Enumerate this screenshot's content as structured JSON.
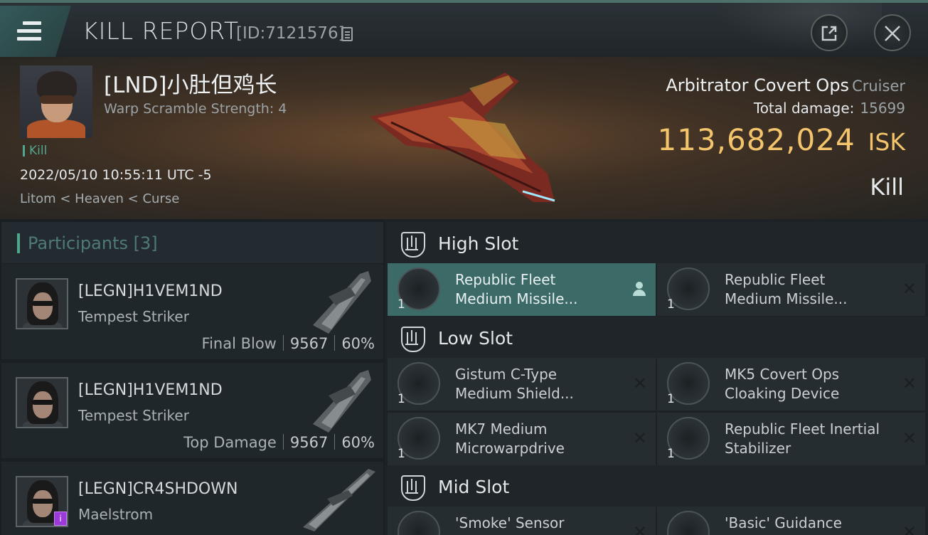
{
  "header": {
    "title": "KILL REPORT",
    "report_id": "[ID:7121576]"
  },
  "victim": {
    "name": "[LND]小肚但鸡长",
    "warp_scramble": "Warp Scramble Strength: 4",
    "tag": "Kill",
    "datetime": "2022/05/10 10:55:11 UTC -5",
    "location": "Litom < Heaven < Curse"
  },
  "ship": {
    "name": "Arbitrator Covert Ops",
    "class": "Cruiser",
    "total_damage_label": "Total damage:",
    "total_damage": "15699",
    "isk_value": "113,682,024",
    "isk_unit": "ISK",
    "result": "Kill"
  },
  "participants": {
    "title": "Participants [3]",
    "items": [
      {
        "name": "[LEGN]H1VEM1ND",
        "ship": "Tempest Striker",
        "role": "Final Blow",
        "damage": "9567",
        "percent": "60%"
      },
      {
        "name": "[LEGN]H1VEM1ND",
        "ship": "Tempest Striker",
        "role": "Top Damage",
        "damage": "9567",
        "percent": "60%"
      },
      {
        "name": "[LEGN]CR4SHDOWN",
        "ship": "Maelstrom"
      }
    ]
  },
  "fitting": {
    "high_slot": {
      "label": "High Slot",
      "modules": [
        {
          "line1": "Republic Fleet",
          "line2": "Medium Missile...",
          "qty": "1"
        },
        {
          "line1": "Republic Fleet",
          "line2": "Medium Missile...",
          "qty": "1"
        }
      ]
    },
    "low_slot": {
      "label": "Low Slot",
      "modules": [
        {
          "line1": "Gistum C-Type",
          "line2": "Medium Shield...",
          "qty": "1"
        },
        {
          "line1": "MK5 Covert Ops",
          "line2": "Cloaking Device",
          "qty": "1"
        },
        {
          "line1": "MK7 Medium",
          "line2": "Microwarpdrive",
          "qty": "1"
        },
        {
          "line1": "Republic Fleet Inertial",
          "line2": "Stabilizer",
          "qty": "1"
        }
      ]
    },
    "mid_slot": {
      "label": "Mid Slot",
      "modules": [
        {
          "line1": "'Smoke' Sensor"
        },
        {
          "line1": "'Basic' Guidance"
        }
      ]
    }
  },
  "colors": {
    "accent": "#4fa78f",
    "isk": "#f3c46c",
    "highlight": "#3c6a67"
  },
  "icons": [
    "menu-icon",
    "copy-icon",
    "share-icon",
    "close-icon",
    "slot-icon",
    "pilot-icon",
    "remove-icon"
  ]
}
